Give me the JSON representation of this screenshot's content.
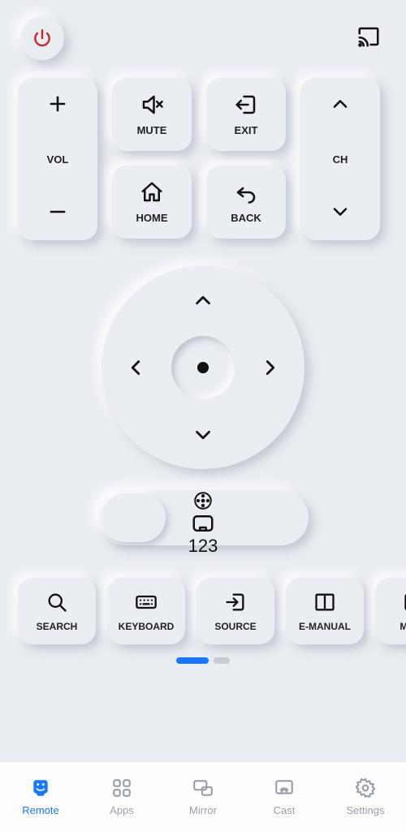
{
  "topbar": {
    "power_icon": "power",
    "cast_icon": "cast"
  },
  "vol": {
    "label": "VOL"
  },
  "ch": {
    "label": "CH"
  },
  "mute": {
    "label": "MUTE"
  },
  "exit": {
    "label": "EXIT"
  },
  "home": {
    "label": "HOME"
  },
  "back": {
    "label": "BACK"
  },
  "mode_pill": {
    "dpad_icon": "dpad-mode",
    "touch_icon": "touchpad-mode",
    "num_label": "123"
  },
  "shortcuts": [
    {
      "label": "SEARCH"
    },
    {
      "label": "KEYBOARD"
    },
    {
      "label": "SOURCE"
    },
    {
      "label": "E-MANUAL"
    },
    {
      "label": "MENU"
    }
  ],
  "tabs": [
    {
      "label": "Remote",
      "active": true
    },
    {
      "label": "Apps"
    },
    {
      "label": "Mirror"
    },
    {
      "label": "Cast"
    },
    {
      "label": "Settings"
    }
  ]
}
